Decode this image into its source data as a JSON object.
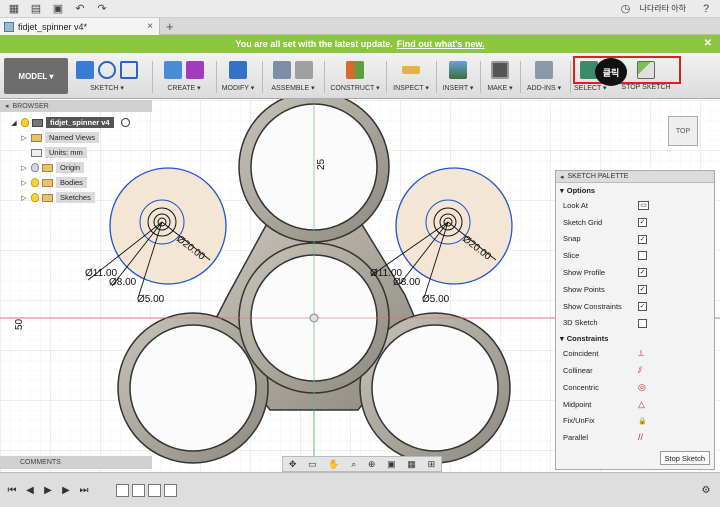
{
  "app": {
    "user_name": "나다라타 아하",
    "document_tab": "fidjet_spinner v4*"
  },
  "banner": {
    "text": "You are all set with the latest update.",
    "link": "Find out what's new."
  },
  "toolbar": {
    "mode": "MODEL",
    "groups": [
      "SKETCH",
      "CREATE",
      "MODIFY",
      "ASSEMBLE",
      "CONSTRUCT",
      "INSPECT",
      "INSERT",
      "MAKE",
      "ADD-INS",
      "SELECT",
      "STOP SKETCH"
    ],
    "annotation": "클릭"
  },
  "browser": {
    "title": "BROWSER",
    "root": "fidjet_spinner v4",
    "items": [
      "Named Views",
      "Units: mm",
      "Origin",
      "Bodies",
      "Sketches"
    ]
  },
  "comments": "COMMENTS",
  "viewcube": "TOP",
  "palette": {
    "title": "SKETCH PALETTE",
    "options_label": "Options",
    "options": [
      {
        "label": "Look At",
        "icon": "look-at-icon"
      },
      {
        "label": "Sketch Grid",
        "checked": "✓"
      },
      {
        "label": "Snap",
        "checked": "✓"
      },
      {
        "label": "Slice",
        "checked": ""
      },
      {
        "label": "Show Profile",
        "checked": "✓"
      },
      {
        "label": "Show Points",
        "checked": "✓"
      },
      {
        "label": "Show Constraints",
        "checked": "✓"
      },
      {
        "label": "3D Sketch",
        "checked": ""
      }
    ],
    "constraints_label": "Constraints",
    "constraints": [
      {
        "label": "Coincident",
        "glyph": "⟂"
      },
      {
        "label": "Collinear",
        "glyph": "⫽"
      },
      {
        "label": "Concentric",
        "glyph": "◎"
      },
      {
        "label": "Midpoint",
        "glyph": "△"
      },
      {
        "label": "Fix/UnFix",
        "glyph": "🔒"
      },
      {
        "label": "Parallel",
        "glyph": "//"
      }
    ],
    "stop_button": "Stop Sketch"
  },
  "dimensions": {
    "axis_25": "25",
    "axis_50": "50",
    "left": [
      "Ø11.00",
      "Ø8.00",
      "Ø5.00",
      "Ø20.00"
    ],
    "right": [
      "Ø11.00",
      "Ø8.00",
      "Ø5.00",
      "Ø20.00"
    ]
  },
  "colors": {
    "banner_green": "#8cc63f",
    "highlight_red": "#e02020",
    "sketch_blue": "#2255cc"
  }
}
